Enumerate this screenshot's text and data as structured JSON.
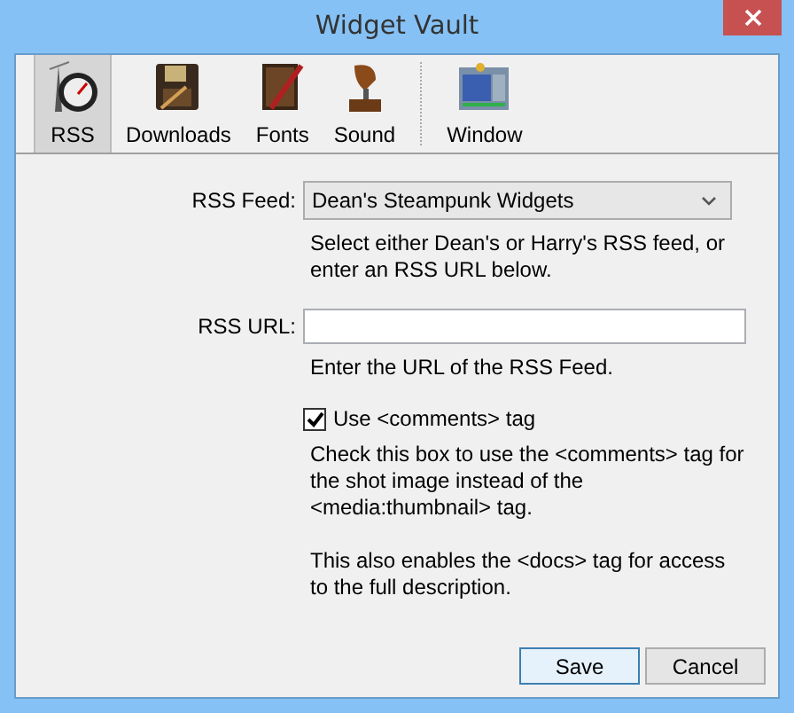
{
  "window": {
    "title": "Widget Vault"
  },
  "toolbar_groups": [
    {
      "items": [
        {
          "label": "RSS",
          "kind": "meter",
          "selected": true
        },
        {
          "label": "Downloads",
          "kind": "disk",
          "selected": false
        },
        {
          "label": "Fonts",
          "kind": "book",
          "selected": false
        },
        {
          "label": "Sound",
          "kind": "gramophone",
          "selected": false
        }
      ]
    },
    {
      "items": [
        {
          "label": "Window",
          "kind": "window",
          "selected": false
        }
      ]
    }
  ],
  "rss_feed": {
    "label": "RSS Feed:",
    "value": "Dean's Steampunk Widgets",
    "help": "Select either Dean's or Harry's RSS feed, or enter an RSS URL below."
  },
  "rss_url": {
    "label": "RSS URL:",
    "help": "Enter the URL of the RSS Feed."
  },
  "comments_option": {
    "label": "Use <comments> tag",
    "checked": true,
    "help": [
      "Check this box to use the <comments> tag for the shot image instead of the <media:thumbnail> tag.",
      "This also enables the <docs> tag for access to the full description."
    ]
  },
  "buttons": [
    {
      "label": "Save",
      "default": true
    },
    {
      "label": "Cancel",
      "default": false
    }
  ]
}
